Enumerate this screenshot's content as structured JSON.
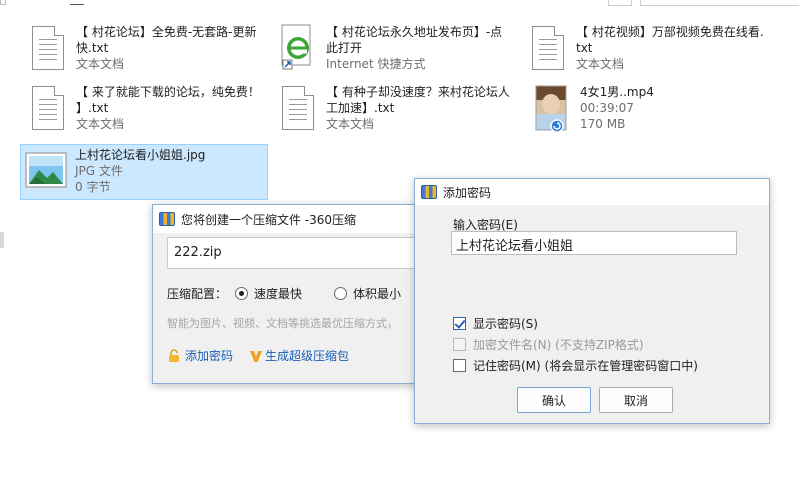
{
  "files": [
    {
      "name_line1": "【 村花论坛】全免费-无套路-更新",
      "name_line2": "快.txt",
      "type": "文本文档",
      "icon": "text-document-icon"
    },
    {
      "name_line1": "【 村花论坛永久地址发布页】-点",
      "name_line2": "此打开",
      "type": "Internet 快捷方式",
      "icon": "internet-shortcut-icon"
    },
    {
      "name_line1": "【 村花视频】万部视频免费在线看.",
      "name_line2": "txt",
      "type": "文本文档",
      "icon": "text-document-icon"
    },
    {
      "name_line1": "【 来了就能下载的论坛，纯免费！",
      "name_line2": "】.txt",
      "type": "文本文档",
      "icon": "text-document-icon"
    },
    {
      "name_line1": "【 有种子却没速度？来村花论坛人",
      "name_line2": "工加速】.txt",
      "type": "文本文档",
      "icon": "text-document-icon"
    },
    {
      "name_line1": "4女1男..mp4",
      "name_line2": "00:39:07",
      "type": "170 MB",
      "icon": "video-thumbnail-icon"
    },
    {
      "name_line1": "上村花论坛看小姐姐.jpg",
      "name_line2": "JPG 文件",
      "type": "0 字节",
      "icon": "image-file-icon"
    }
  ],
  "compress_dialog": {
    "title": "您将创建一个压缩文件 -360压缩",
    "filename": "222.zip",
    "config_label": "压缩配置：",
    "option_fast": "速度最快",
    "option_small": "体积最小",
    "hint": "智能为图片、视频、文档等挑选最优压缩方式，",
    "add_password": "添加密码",
    "super_compress": "生成超级压缩包"
  },
  "password_dialog": {
    "title": "添加密码",
    "input_label": "输入密码(E)",
    "password_value": "上村花论坛看小姐姐",
    "show_password": "显示密码(S)",
    "encrypt_names": "加密文件名(N)  (不支持ZIP格式)",
    "remember_password": "记住密码(M)  (将会显示在管理密码窗口中)",
    "ok": "确认",
    "cancel": "取消"
  }
}
